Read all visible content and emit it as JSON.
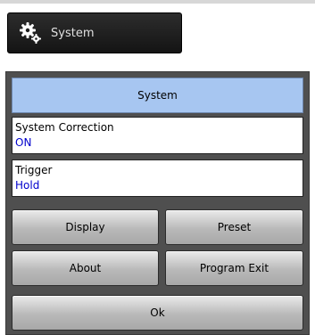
{
  "system_button": {
    "label": "System",
    "icon": "gear-icon"
  },
  "panel": {
    "title": "System",
    "fields": [
      {
        "label": "System Correction",
        "value": "ON"
      },
      {
        "label": "Trigger",
        "value": "Hold"
      }
    ],
    "buttons": {
      "display": "Display",
      "preset": "Preset",
      "about": "About",
      "program_exit": "Program Exit",
      "ok": "Ok"
    }
  },
  "colors": {
    "title_bg": "#a7c6f1",
    "value_text": "#0000cc"
  }
}
